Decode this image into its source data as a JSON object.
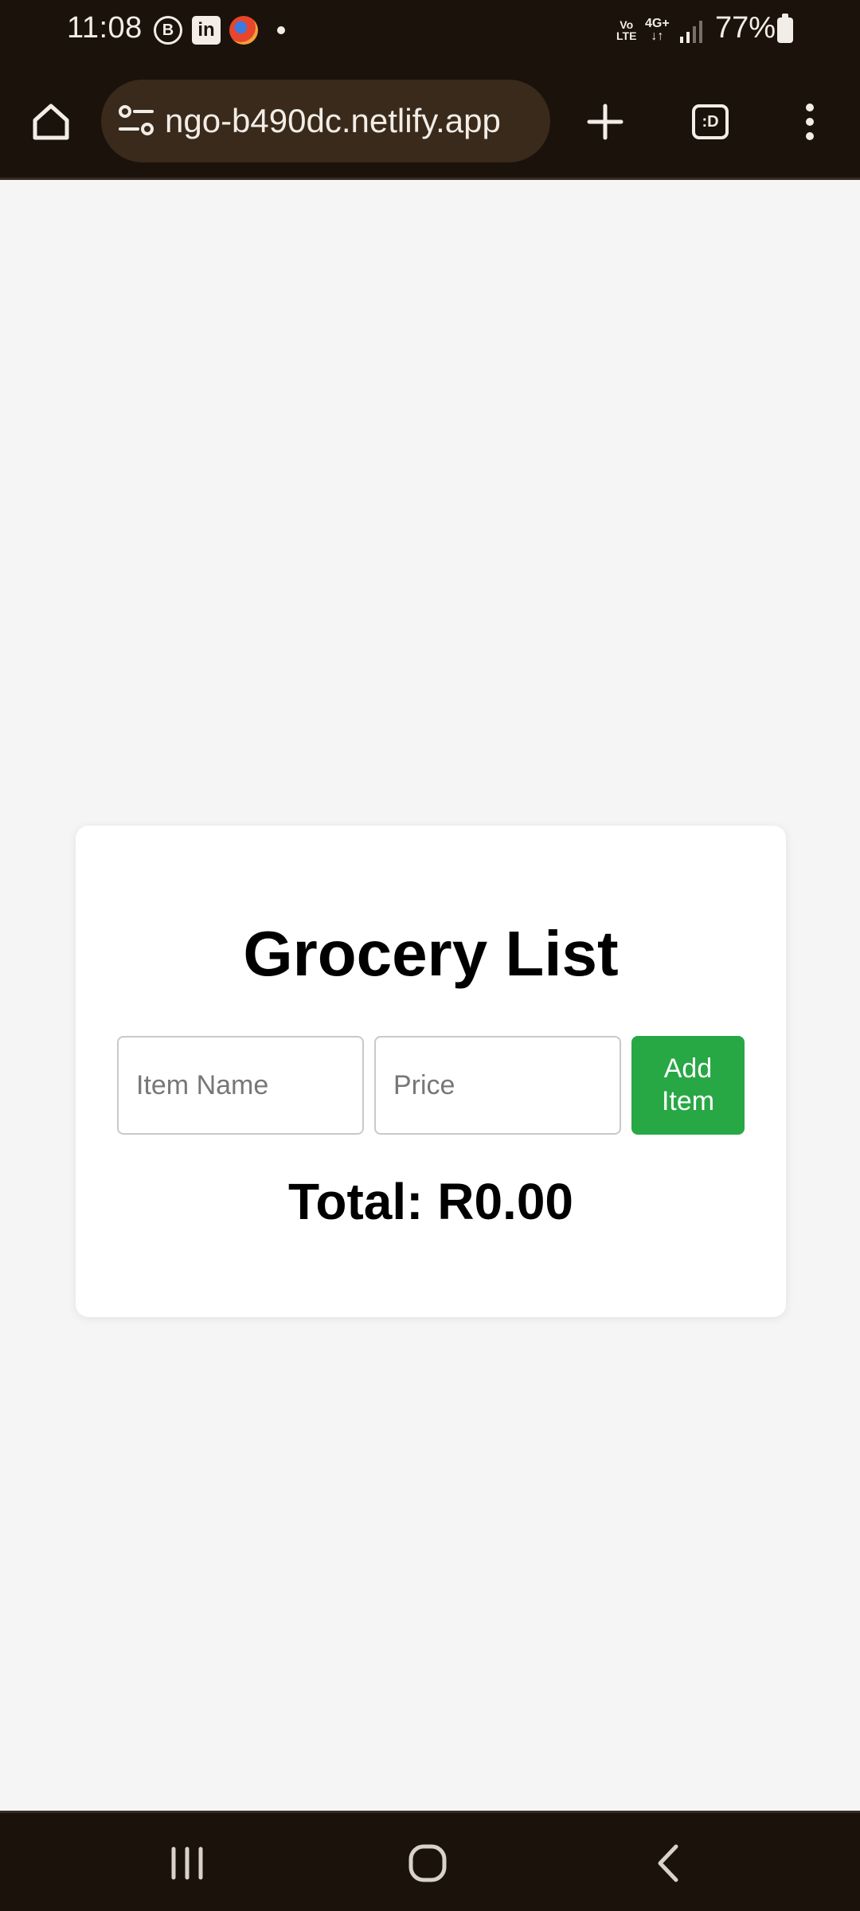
{
  "status_bar": {
    "time": "11:08",
    "notif_b": "B",
    "notif_linkedin": "in",
    "volte_top": "Vo",
    "volte_bottom": "LTE",
    "network_top": "4G+",
    "network_bottom": "↓↑",
    "battery": "77%"
  },
  "browser": {
    "url": "ngo-b490dc.netlify.app",
    "tab_count": ":D"
  },
  "page": {
    "title": "Grocery List",
    "item_name_placeholder": "Item Name",
    "price_placeholder": "Price",
    "add_button_line1": "Add",
    "add_button_line2": "Item",
    "total": "Total: R0.00"
  },
  "colors": {
    "accent_green": "#28a745",
    "browser_chrome": "#1b120b",
    "page_background": "#f5f5f5"
  }
}
